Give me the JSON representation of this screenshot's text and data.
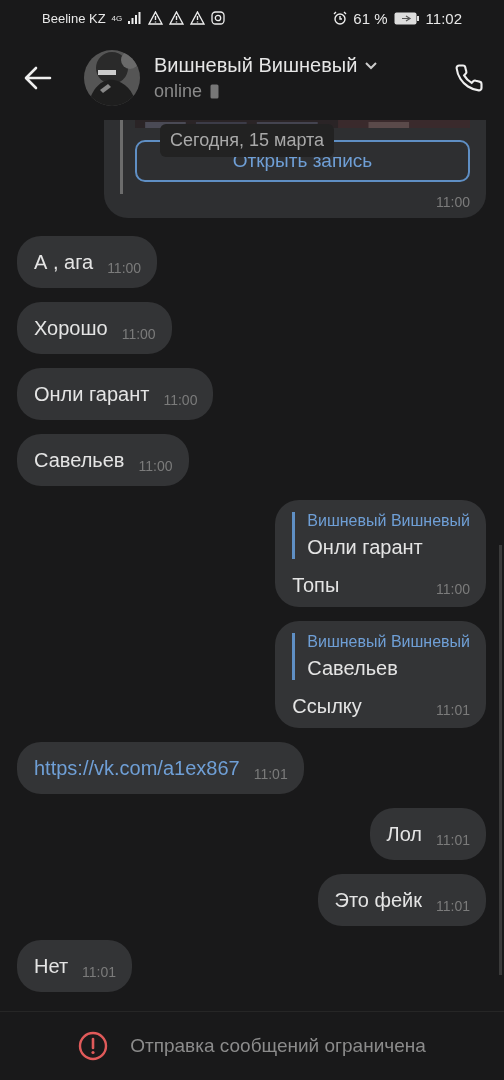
{
  "status_bar": {
    "carrier": "Beeline KZ",
    "network": "4G",
    "battery": "61 %",
    "time": "11:02"
  },
  "header": {
    "name": "Вишневый Вишневый",
    "status": "online"
  },
  "date_tooltip": "Сегодня, 15 марта",
  "post_card": {
    "button": "Открыть запись",
    "time": "11:00"
  },
  "messages": [
    {
      "kind": "text",
      "outgoing": false,
      "text": "А , ага",
      "time": "11:00"
    },
    {
      "kind": "text",
      "outgoing": false,
      "text": "Хорошо",
      "time": "11:00"
    },
    {
      "kind": "text",
      "outgoing": false,
      "text": "Онли гарант",
      "time": "11:00"
    },
    {
      "kind": "text",
      "outgoing": false,
      "text": "Савельев",
      "time": "11:00"
    },
    {
      "kind": "reply",
      "outgoing": true,
      "quote_author": "Вишневый Вишневый",
      "quote_text": "Онли гарант",
      "text": "Топы",
      "time": "11:00"
    },
    {
      "kind": "reply",
      "outgoing": true,
      "quote_author": "Вишневый Вишневый",
      "quote_text": "Савельев",
      "text": "Ссылку",
      "time": "11:01"
    },
    {
      "kind": "link",
      "outgoing": false,
      "text": "https://vk.com/a1ex867",
      "time": "11:01"
    },
    {
      "kind": "text",
      "outgoing": true,
      "text": "Лол",
      "time": "11:01"
    },
    {
      "kind": "text",
      "outgoing": true,
      "text": "Это фейк",
      "time": "11:01"
    },
    {
      "kind": "text",
      "outgoing": false,
      "text": "Нет",
      "time": "11:01"
    }
  ],
  "footer": {
    "notice": "Отправка сообщений ограничена"
  }
}
